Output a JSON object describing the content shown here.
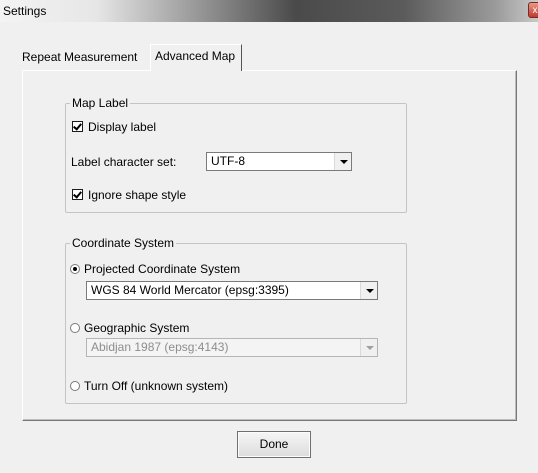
{
  "window": {
    "title": "Settings",
    "close_icon": "close-icon",
    "close_symbol": "x"
  },
  "tabs": [
    {
      "label": "Repeat Measurement",
      "selected": false
    },
    {
      "label": "Advanced Map",
      "selected": true
    }
  ],
  "map_label": {
    "legend": "Map Label",
    "display_label": {
      "label": "Display label",
      "checked": true
    },
    "charset": {
      "label": "Label character set:",
      "value": "UTF-8"
    },
    "ignore_shape_style": {
      "label": "Ignore shape style",
      "checked": true
    }
  },
  "coordinate_system": {
    "legend": "Coordinate System",
    "projected": {
      "label": "Projected Coordinate System",
      "selected": true,
      "value": "WGS 84 World Mercator (epsg:3395)"
    },
    "geographic": {
      "label": "Geographic System",
      "selected": false,
      "value": "Abidjan 1987 (epsg:4143)",
      "disabled": true
    },
    "turn_off": {
      "label": "Turn Off (unknown system)",
      "selected": false
    }
  },
  "footer": {
    "done_label": "Done"
  }
}
